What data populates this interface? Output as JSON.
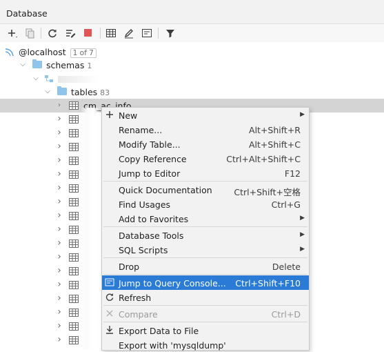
{
  "window": {
    "title": "Database"
  },
  "toolbar": {
    "buttons": [
      "add-icon",
      "duplicate-icon",
      "refresh-icon",
      "edit-datasource-icon",
      "stop-icon",
      "table-editor-icon",
      "edit-icon",
      "sql-console-icon",
      "filter-icon"
    ]
  },
  "tree": {
    "host": {
      "label": "@localhost",
      "badge": "1 of 7"
    },
    "schemas": {
      "label": "schemas",
      "count": "1"
    },
    "tables": {
      "label": "tables",
      "count": "83"
    },
    "selected_table": "cm_ac_info"
  },
  "menu": {
    "new": "New",
    "rename": "Rename...",
    "rename_sc": "Alt+Shift+R",
    "modify_table": "Modify Table...",
    "modify_table_sc": "Alt+Shift+C",
    "copy_reference": "Copy Reference",
    "copy_reference_sc": "Ctrl+Alt+Shift+C",
    "jump_to_editor": "Jump to Editor",
    "jump_to_editor_sc": "F12",
    "quick_documentation": "Quick Documentation",
    "quick_documentation_sc": "Ctrl+Shift+空格",
    "find_usages": "Find Usages",
    "find_usages_sc": "Ctrl+G",
    "add_to_favorites": "Add to Favorites",
    "database_tools": "Database Tools",
    "sql_scripts": "SQL Scripts",
    "drop": "Drop",
    "drop_sc": "Delete",
    "jump_to_query_console": "Jump to Query Console...",
    "jump_to_query_console_sc": "Ctrl+Shift+F10",
    "refresh": "Refresh",
    "compare": "Compare",
    "compare_sc": "Ctrl+D",
    "export_data_to_file": "Export Data to File",
    "export_with_mysqldump": "Export with 'mysqldump'"
  },
  "colors": {
    "highlight": "#2a7bd6",
    "folder": "#8fc5ea",
    "stop": "#e05555"
  }
}
